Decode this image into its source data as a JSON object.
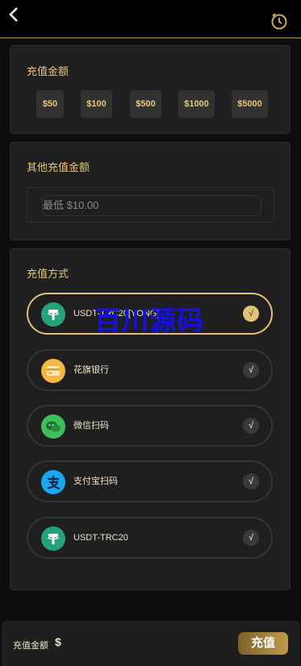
{
  "header": {
    "back_icon": "chevron-left-icon",
    "history_icon": "clock-history-icon"
  },
  "amount_section": {
    "title": "充值金额",
    "options": [
      "$50",
      "$100",
      "$500",
      "$1000",
      "$5000"
    ]
  },
  "custom_section": {
    "title": "其他充值金额",
    "placeholder": "最低 $10.00"
  },
  "method_section": {
    "title": "充值方式",
    "methods": [
      {
        "label": "USDT-TRC20[YONG]",
        "icon": "tether-icon",
        "selected": true,
        "check": "√"
      },
      {
        "label": "花旗银行",
        "icon": "bank-card-icon",
        "selected": false,
        "check": "√"
      },
      {
        "label": "微信扫码",
        "icon": "wechat-icon",
        "selected": false,
        "check": "√"
      },
      {
        "label": "支付宝扫码",
        "icon": "alipay-icon",
        "selected": false,
        "check": "√"
      },
      {
        "label": "USDT-TRC20",
        "icon": "tether-icon",
        "selected": false,
        "check": "√"
      }
    ]
  },
  "watermark": "百川源码",
  "footer": {
    "label": "充值金额",
    "currency": "$",
    "button": "充值"
  },
  "colors": {
    "accent": "#e9c77a",
    "card": "#1f1f1f",
    "background": "#0d0d0d",
    "watermark": "#1410e8"
  }
}
